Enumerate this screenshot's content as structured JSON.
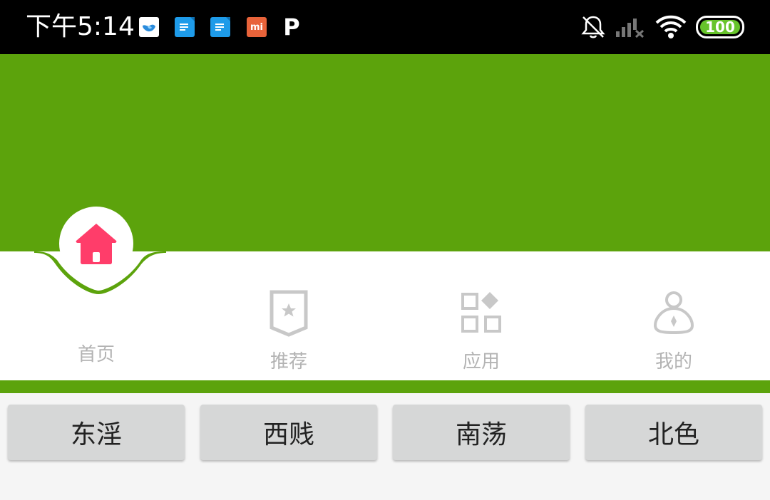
{
  "status_bar": {
    "time": "下午5:14",
    "notification_icons": [
      "bird-app-icon",
      "docs-icon",
      "docs-icon",
      "mi-icon",
      "p-app-icon"
    ],
    "mi_label": "mi",
    "p_label": "P",
    "battery_level": "100",
    "colors": {
      "background": "#000000",
      "battery_fill": "#67c42b"
    }
  },
  "header": {
    "color": "#5ca30c"
  },
  "tabs": [
    {
      "label": "首页",
      "icon": "home-icon",
      "active": true
    },
    {
      "label": "推荐",
      "icon": "star-badge-icon",
      "active": false
    },
    {
      "label": "应用",
      "icon": "grid-apps-icon",
      "active": false
    },
    {
      "label": "我的",
      "icon": "person-icon",
      "active": false
    }
  ],
  "buttons": [
    {
      "label": "东淫"
    },
    {
      "label": "西贱"
    },
    {
      "label": "南荡"
    },
    {
      "label": "北色"
    }
  ],
  "colors": {
    "accent": "#ff3d6a",
    "inactive": "#b3b3b3",
    "button_bg": "#d6d7d7"
  }
}
